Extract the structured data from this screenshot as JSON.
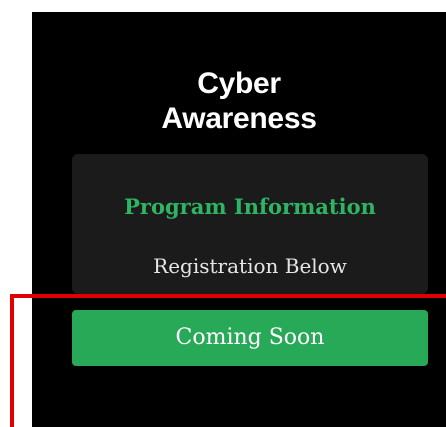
{
  "header": {
    "title_line1": "Cyber",
    "title_line2": "Awareness"
  },
  "card": {
    "heading": "Program Information",
    "subtext": "Registration Below"
  },
  "cta": {
    "label": "Coming Soon"
  },
  "colors": {
    "background": "#000000",
    "card": "#1b1b1b",
    "accent_green": "#27a957",
    "heading_green": "#2fb463",
    "highlight_red": "#e00000"
  }
}
